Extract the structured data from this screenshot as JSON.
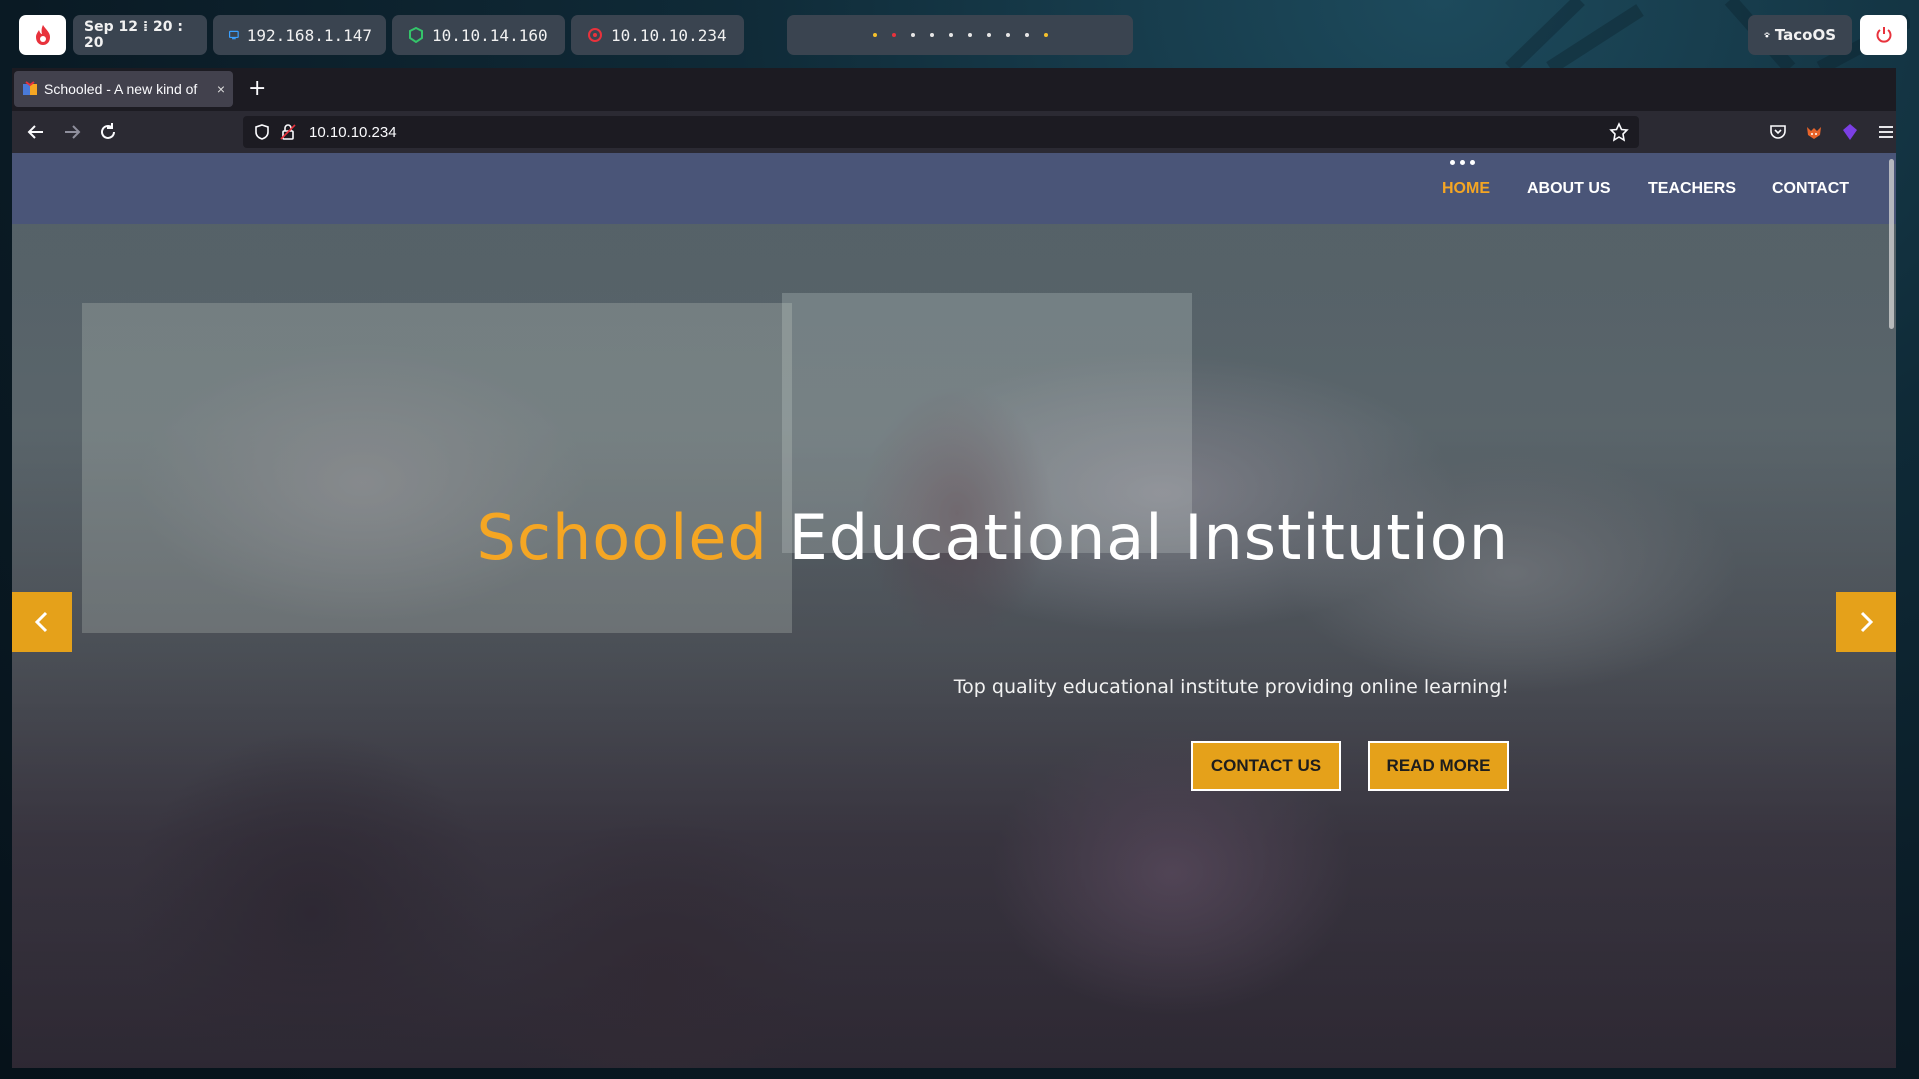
{
  "desktop": {
    "clock": "Sep 12 ⁞ 20 : 20",
    "ips": [
      {
        "label": "192.168.1.147",
        "icon": "monitor-icon",
        "color": "#3aa0ff"
      },
      {
        "label": "10.10.14.160",
        "icon": "vpn-shield-icon",
        "color": "#34c46a"
      },
      {
        "label": "10.10.10.234",
        "icon": "target-icon",
        "color": "#e8323c"
      }
    ],
    "os_name": "TacoOS",
    "workspace_dot_colors": [
      "#f5c12b",
      "#e8323c",
      "#e6e6e6",
      "#e6e6e6",
      "#e6e6e6",
      "#e6e6e6",
      "#e6e6e6",
      "#e6e6e6",
      "#e6e6e6",
      "#f5c12b"
    ]
  },
  "browser": {
    "tab_title": "Schooled - A new kind of",
    "tab_close": "×",
    "new_tab": "+",
    "url": "10.10.10.234"
  },
  "site": {
    "nav": {
      "items": [
        "HOME",
        "ABOUT US",
        "TEACHERS",
        "CONTACT"
      ],
      "active": "HOME"
    },
    "hero": {
      "title_accent": "Schooled",
      "title_rest": "Educational Institution",
      "subtitle": "Top quality educational institute providing online learning!",
      "buttons": [
        "CONTACT US",
        "READ MORE"
      ]
    },
    "accent_color": "#e5a11a",
    "nav_color": "#4a5578"
  }
}
